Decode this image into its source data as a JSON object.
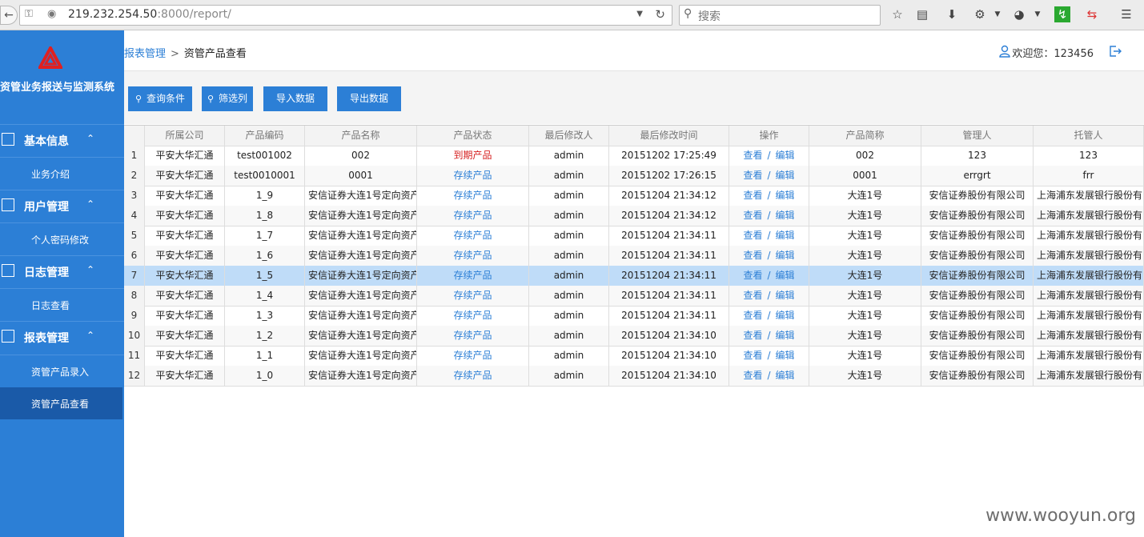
{
  "browser": {
    "url_host": "219.232.254.50",
    "url_rest": ":8000/report/",
    "search_placeholder": "搜索"
  },
  "sidebar": {
    "title": "资管业务报送与监测系统",
    "groups": [
      {
        "label": "基本信息",
        "items": [
          "业务介绍"
        ]
      },
      {
        "label": "用户管理",
        "items": [
          "个人密码修改"
        ]
      },
      {
        "label": "日志管理",
        "items": [
          "日志查看"
        ]
      },
      {
        "label": "报表管理",
        "items": [
          "资管产品录入",
          "资管产品查看"
        ]
      }
    ]
  },
  "header": {
    "breadcrumb_parent": "报表管理",
    "breadcrumb_sep": ">",
    "breadcrumb_current": "资管产品查看",
    "welcome": "欢迎您：123456"
  },
  "toolbar": {
    "query": "查询条件",
    "filter": "筛选列",
    "import": "导入数据",
    "export": "导出数据"
  },
  "table": {
    "columns": [
      "所属公司",
      "产品编码",
      "产品名称",
      "产品状态",
      "最后修改人",
      "最后修改时间",
      "操作",
      "产品简称",
      "管理人",
      "托管人"
    ],
    "op_view": "查看",
    "op_sep": "/",
    "op_edit": "编辑",
    "rows": [
      {
        "idx": "1",
        "company": "平安大华汇通",
        "code": "test001002",
        "name": "002",
        "status": "到期产品",
        "status_type": "expired",
        "user": "admin",
        "time": "20151202 17:25:49",
        "short": "002",
        "manager": "123",
        "custodian": "123"
      },
      {
        "idx": "2",
        "company": "平安大华汇通",
        "code": "test0010001",
        "name": "0001",
        "status": "存续产品",
        "status_type": "active",
        "user": "admin",
        "time": "20151202 17:26:15",
        "short": "0001",
        "manager": "errgrt",
        "custodian": "frr"
      },
      {
        "idx": "3",
        "company": "平安大华汇通",
        "code": "1_9",
        "name": "安信证券大连1号定向资产",
        "status": "存续产品",
        "status_type": "active",
        "user": "admin",
        "time": "20151204 21:34:12",
        "short": "大连1号",
        "manager": "安信证券股份有限公司",
        "custodian": "上海浦东发展银行股份有"
      },
      {
        "idx": "4",
        "company": "平安大华汇通",
        "code": "1_8",
        "name": "安信证券大连1号定向资产",
        "status": "存续产品",
        "status_type": "active",
        "user": "admin",
        "time": "20151204 21:34:12",
        "short": "大连1号",
        "manager": "安信证券股份有限公司",
        "custodian": "上海浦东发展银行股份有"
      },
      {
        "idx": "5",
        "company": "平安大华汇通",
        "code": "1_7",
        "name": "安信证券大连1号定向资产",
        "status": "存续产品",
        "status_type": "active",
        "user": "admin",
        "time": "20151204 21:34:11",
        "short": "大连1号",
        "manager": "安信证券股份有限公司",
        "custodian": "上海浦东发展银行股份有"
      },
      {
        "idx": "6",
        "company": "平安大华汇通",
        "code": "1_6",
        "name": "安信证券大连1号定向资产",
        "status": "存续产品",
        "status_type": "active",
        "user": "admin",
        "time": "20151204 21:34:11",
        "short": "大连1号",
        "manager": "安信证券股份有限公司",
        "custodian": "上海浦东发展银行股份有"
      },
      {
        "idx": "7",
        "company": "平安大华汇通",
        "code": "1_5",
        "name": "安信证券大连1号定向资产",
        "status": "存续产品",
        "status_type": "active",
        "user": "admin",
        "time": "20151204 21:34:11",
        "short": "大连1号",
        "manager": "安信证券股份有限公司",
        "custodian": "上海浦东发展银行股份有",
        "selected": true
      },
      {
        "idx": "8",
        "company": "平安大华汇通",
        "code": "1_4",
        "name": "安信证券大连1号定向资产",
        "status": "存续产品",
        "status_type": "active",
        "user": "admin",
        "time": "20151204 21:34:11",
        "short": "大连1号",
        "manager": "安信证券股份有限公司",
        "custodian": "上海浦东发展银行股份有"
      },
      {
        "idx": "9",
        "company": "平安大华汇通",
        "code": "1_3",
        "name": "安信证券大连1号定向资产",
        "status": "存续产品",
        "status_type": "active",
        "user": "admin",
        "time": "20151204 21:34:11",
        "short": "大连1号",
        "manager": "安信证券股份有限公司",
        "custodian": "上海浦东发展银行股份有"
      },
      {
        "idx": "10",
        "company": "平安大华汇通",
        "code": "1_2",
        "name": "安信证券大连1号定向资产",
        "status": "存续产品",
        "status_type": "active",
        "user": "admin",
        "time": "20151204 21:34:10",
        "short": "大连1号",
        "manager": "安信证券股份有限公司",
        "custodian": "上海浦东发展银行股份有"
      },
      {
        "idx": "11",
        "company": "平安大华汇通",
        "code": "1_1",
        "name": "安信证券大连1号定向资产",
        "status": "存续产品",
        "status_type": "active",
        "user": "admin",
        "time": "20151204 21:34:10",
        "short": "大连1号",
        "manager": "安信证券股份有限公司",
        "custodian": "上海浦东发展银行股份有"
      },
      {
        "idx": "12",
        "company": "平安大华汇通",
        "code": "1_0",
        "name": "安信证券大连1号定向资产",
        "status": "存续产品",
        "status_type": "active",
        "user": "admin",
        "time": "20151204 21:34:10",
        "short": "大连1号",
        "manager": "安信证券股份有限公司",
        "custodian": "上海浦东发展银行股份有"
      }
    ]
  },
  "watermark": "www.wooyun.org"
}
